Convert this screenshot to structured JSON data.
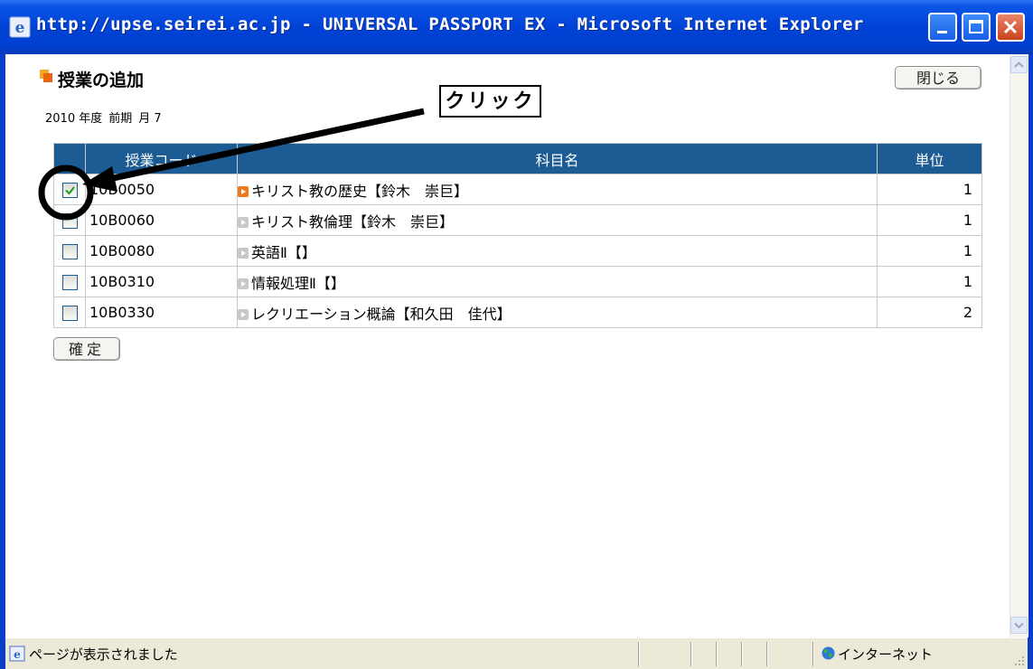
{
  "window": {
    "title": "http://upse.seirei.ac.jp - UNIVERSAL PASSPORT EX - Microsoft Internet Explorer",
    "frame_color": "#0042d6"
  },
  "page": {
    "heading": "授業の追加",
    "close_label": "閉じる",
    "year": "2010 年度",
    "term": "前期",
    "slot": "月 7"
  },
  "table": {
    "header_color": "#1c5b93",
    "columns": [
      "授業コード",
      "科目名",
      "単位"
    ],
    "rows": [
      {
        "code": "10B0050",
        "name": "キリスト教の歴史【鈴木　崇巨】",
        "unit": "1",
        "checked": true
      },
      {
        "code": "10B0060",
        "name": "キリスト教倫理【鈴木　崇巨】",
        "unit": "1",
        "checked": false
      },
      {
        "code": "10B0080",
        "name": "英語Ⅱ【】",
        "unit": "1",
        "checked": false
      },
      {
        "code": "10B0310",
        "name": "情報処理Ⅱ【】",
        "unit": "1",
        "checked": false
      },
      {
        "code": "10B0330",
        "name": "レクリエーション概論【和久田　佳代】",
        "unit": "2",
        "checked": false
      }
    ]
  },
  "confirm_label": "確定",
  "annotation": {
    "callout": "クリック"
  },
  "statusbar": {
    "text": "ページが表示されました",
    "zone": "インターネット"
  }
}
